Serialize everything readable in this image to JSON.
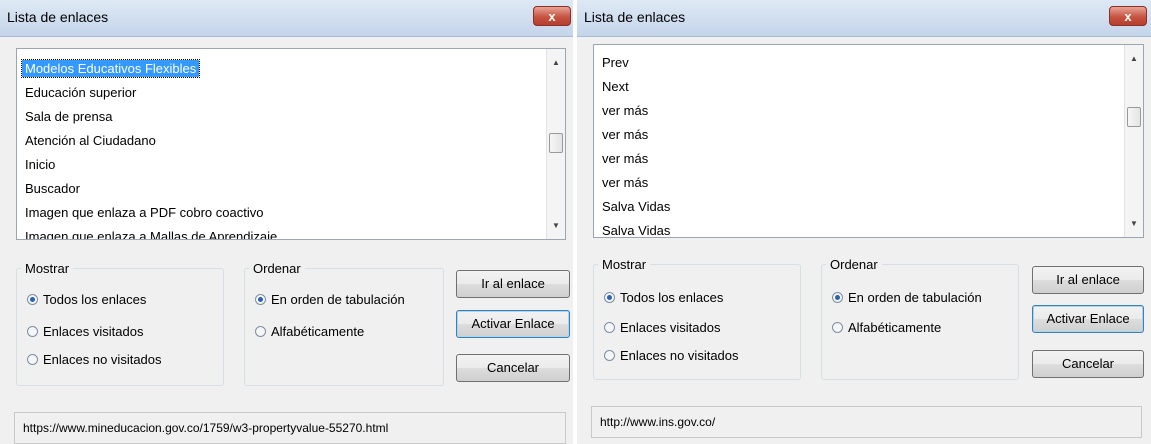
{
  "dialogs": [
    {
      "title": "Lista de enlaces",
      "close_label": "x",
      "links": [
        "Modelos Educativos Flexibles",
        "Educación superior",
        "Sala de prensa",
        "Atención al Ciudadano",
        "Inicio",
        "Buscador",
        "Imagen que enlaza a PDF cobro coactivo",
        "Imagen que enlaza a Mallas de Aprendizaje"
      ],
      "selected_index": 0,
      "show_group": {
        "label": "Mostrar",
        "options": [
          "Todos los enlaces",
          "Enlaces visitados",
          "Enlaces no visitados"
        ],
        "selected": 0
      },
      "order_group": {
        "label": "Ordenar",
        "options": [
          "En orden de tabulación",
          "Alfabéticamente"
        ],
        "selected": 0
      },
      "buttons": {
        "go": "Ir al enlace",
        "activate": "Activar Enlace",
        "cancel": "Cancelar"
      },
      "status_url": "https://www.mineducacion.gov.co/1759/w3-propertyvalue-55270.html"
    },
    {
      "title": "Lista de enlaces",
      "close_label": "x",
      "links": [
        "Prev",
        "Next",
        "ver más",
        "ver más",
        "ver más",
        "ver más",
        "Salva Vidas",
        "Salva Vidas"
      ],
      "selected_index": -1,
      "show_group": {
        "label": "Mostrar",
        "options": [
          "Todos los enlaces",
          "Enlaces visitados",
          "Enlaces no visitados"
        ],
        "selected": 0
      },
      "order_group": {
        "label": "Ordenar",
        "options": [
          "En orden de tabulación",
          "Alfabéticamente"
        ],
        "selected": 0
      },
      "buttons": {
        "go": "Ir al enlace",
        "activate": "Activar Enlace",
        "cancel": "Cancelar"
      },
      "status_url": "http://www.ins.gov.co/"
    }
  ]
}
